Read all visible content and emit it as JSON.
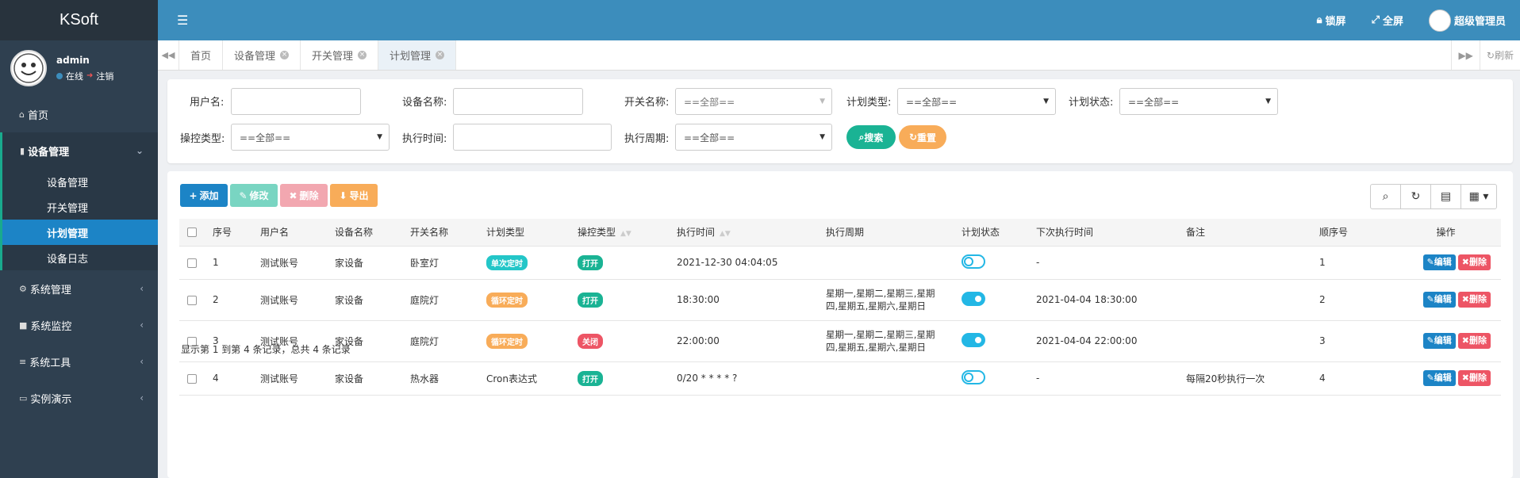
{
  "app": {
    "title": "KSoft"
  },
  "user": {
    "name": "admin",
    "status": "在线",
    "logout": "注销"
  },
  "sidebar": {
    "items": [
      {
        "label": "首页",
        "icon": "home-icon"
      },
      {
        "label": "设备管理",
        "icon": "device-icon"
      },
      {
        "label": "系统管理",
        "icon": "gear-icon"
      },
      {
        "label": "系统监控",
        "icon": "video-icon"
      },
      {
        "label": "系统工具",
        "icon": "bars-icon"
      },
      {
        "label": "实例演示",
        "icon": "desktop-icon"
      }
    ],
    "sub_items": [
      "设备管理",
      "开关管理",
      "计划管理",
      "设备日志"
    ]
  },
  "header": {
    "lock": "锁屏",
    "fullscreen": "全屏",
    "admin_name": "超级管理员"
  },
  "tabs": [
    {
      "label": "首页"
    },
    {
      "label": "设备管理"
    },
    {
      "label": "开关管理"
    },
    {
      "label": "计划管理"
    }
  ],
  "tab_refresh": "刷新",
  "filters": {
    "username_label": "用户名:",
    "device_label": "设备名称:",
    "switch_label": "开关名称:",
    "switch_value": "==全部==",
    "plan_type_label": "计划类型:",
    "plan_type_value": "==全部==",
    "plan_status_label": "计划状态:",
    "plan_status_value": "==全部==",
    "op_type_label": "操控类型:",
    "op_type_value": "==全部==",
    "exec_time_label": "执行时间:",
    "exec_cycle_label": "执行周期:",
    "exec_cycle_value": "==全部==",
    "search": "搜索",
    "reset": "重置"
  },
  "toolbar": {
    "add": "添加",
    "edit": "修改",
    "delete": "删除",
    "export": "导出"
  },
  "table": {
    "headers": [
      "序号",
      "用户名",
      "设备名称",
      "开关名称",
      "计划类型",
      "操控类型",
      "执行时间",
      "执行周期",
      "计划状态",
      "下次执行时间",
      "备注",
      "顺序号",
      "操作"
    ],
    "rows": [
      {
        "no": "1",
        "user": "测试账号",
        "device": "家设备",
        "switch": "卧室灯",
        "plan_type": "单次定时",
        "op_type": "打开",
        "exec_time": "2021-12-30 04:04:05",
        "cycle1": "",
        "cycle2": "",
        "state": "off",
        "next_time": "-",
        "remark": "",
        "order": "1"
      },
      {
        "no": "2",
        "user": "测试账号",
        "device": "家设备",
        "switch": "庭院灯",
        "plan_type": "循环定时",
        "op_type": "打开",
        "exec_time": "18:30:00",
        "cycle1": "星期一,星期二,星期三,星期",
        "cycle2": "四,星期五,星期六,星期日",
        "state": "on",
        "next_time": "2021-04-04 18:30:00",
        "remark": "",
        "order": "2"
      },
      {
        "no": "3",
        "user": "测试账号",
        "device": "家设备",
        "switch": "庭院灯",
        "plan_type": "循环定时",
        "op_type": "关闭",
        "exec_time": "22:00:00",
        "cycle1": "星期一,星期二,星期三,星期",
        "cycle2": "四,星期五,星期六,星期日",
        "state": "on",
        "next_time": "2021-04-04 22:00:00",
        "remark": "",
        "order": "3"
      },
      {
        "no": "4",
        "user": "测试账号",
        "device": "家设备",
        "switch": "热水器",
        "plan_type": "Cron表达式",
        "op_type": "打开",
        "exec_time": "0/20 * * * * ?",
        "cycle1": "",
        "cycle2": "",
        "state": "off",
        "next_time": "-",
        "remark": "每隔20秒执行一次",
        "order": "4"
      }
    ],
    "edit_label": "编辑",
    "delete_label": "删除"
  },
  "footer": {
    "summary": "显示第 1 到第 4 条记录，总共 4 条记录"
  },
  "colors": {
    "accent": "#3c8dbc",
    "sidebar": "#2f4050",
    "success": "#1ab394",
    "warning": "#f8ac59",
    "danger": "#ed5565",
    "info": "#23c6c8"
  }
}
